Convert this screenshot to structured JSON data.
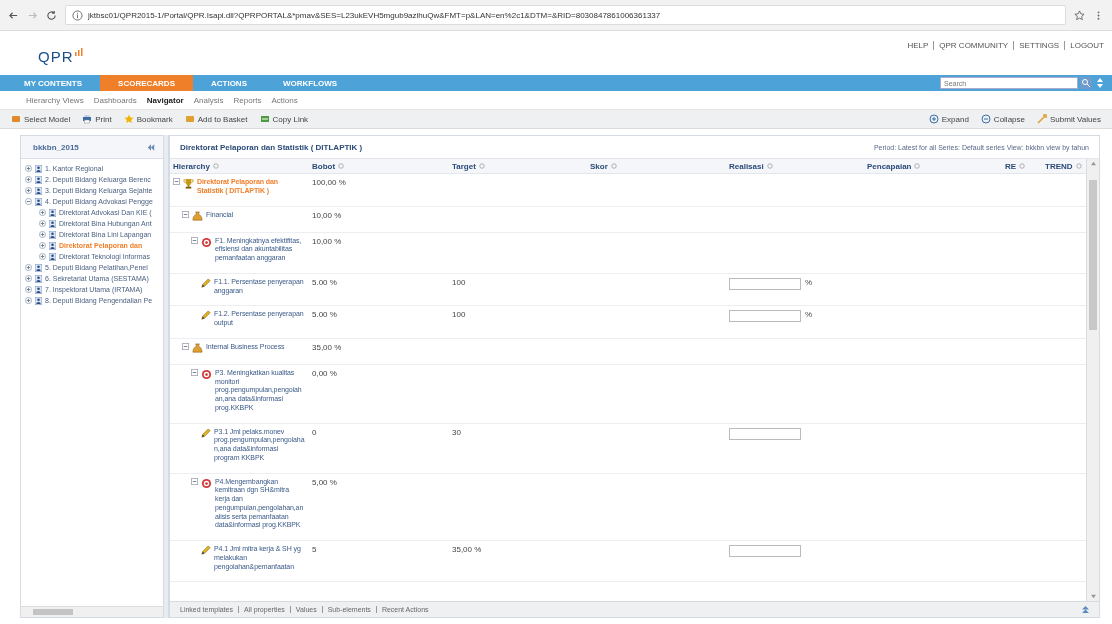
{
  "browser": {
    "url": "jktbsc01/QPR2015-1/Portal/QPR.Isapi.dll?QPRPORTAL&*pmav&SES=L23ukEVH5mgub9azihuQw&FMT=p&LAN=en%2c1&DTM=&RID=8030847861006361337"
  },
  "header": {
    "logo": "QPR",
    "links": [
      "HELP",
      "QPR COMMUNITY",
      "SETTINGS",
      "LOGOUT"
    ]
  },
  "nav_tabs": [
    {
      "label": "MY CONTENTS",
      "selected": false
    },
    {
      "label": "SCORECARDS",
      "selected": true
    },
    {
      "label": "ACTIONS",
      "selected": false
    },
    {
      "label": "WORKFLOWS",
      "selected": false
    }
  ],
  "search": {
    "placeholder": "Search"
  },
  "sub_tabs": [
    {
      "label": "Hierarchy Views",
      "selected": false
    },
    {
      "label": "Dashboards",
      "selected": false
    },
    {
      "label": "Navigator",
      "selected": true
    },
    {
      "label": "Analysis",
      "selected": false
    },
    {
      "label": "Reports",
      "selected": false
    },
    {
      "label": "Actions",
      "selected": false
    }
  ],
  "toolbar": {
    "left": [
      {
        "label": "Select Model",
        "kind": "model"
      },
      {
        "label": "Print",
        "kind": "print"
      },
      {
        "label": "Bookmark",
        "kind": "star"
      },
      {
        "label": "Add to Basket",
        "kind": "basket"
      },
      {
        "label": "Copy Link",
        "kind": "link"
      }
    ],
    "right": [
      {
        "label": "Expand",
        "kind": "expand"
      },
      {
        "label": "Collapse",
        "kind": "collapse"
      },
      {
        "label": "Submit Values",
        "kind": "submit"
      }
    ]
  },
  "sidebar": {
    "title": "bkkbn_2015",
    "items": [
      {
        "label": "1. Kantor Regional",
        "expanded": false,
        "selected": false
      },
      {
        "label": "2. Deputi Bidang Keluarga Berenc",
        "expanded": false,
        "selected": false
      },
      {
        "label": "3. Deputi Bidang Keluarga Sejahte",
        "expanded": false,
        "selected": false
      },
      {
        "label": "4. Deputi Bidang Advokasi Pengge",
        "expanded": true,
        "selected": false,
        "children": [
          {
            "label": "Direktorat Advokasi Dan KIE (",
            "expanded": false,
            "selected": false
          },
          {
            "label": "Direktorat Bina Hubungan Ant",
            "expanded": false,
            "selected": false
          },
          {
            "label": "Direktorat Bina Lini Lapangan",
            "expanded": false,
            "selected": false
          },
          {
            "label": "Direktorat Pelaporan dan",
            "expanded": false,
            "selected": true
          },
          {
            "label": "Direktorat Teknologi Informas",
            "expanded": false,
            "selected": false
          }
        ]
      },
      {
        "label": "5. Deputi Bidang Pelatihan,Penel",
        "expanded": false,
        "selected": false
      },
      {
        "label": "6. Sekretariat Utama (SESTAMA)",
        "expanded": false,
        "selected": false
      },
      {
        "label": "7. Inspektorat Utama (IRTAMA)",
        "expanded": false,
        "selected": false
      },
      {
        "label": "8. Deputi Bidang Pengendalian Pe",
        "expanded": false,
        "selected": false
      }
    ]
  },
  "main": {
    "title": "Direktorat Pelaporan dan Statistik ( DITLAPTIK )",
    "period": "Period: Latest for all  Series: Default series  View: bkkbn view by tahun",
    "columns": [
      "Hierarchy",
      "Bobot",
      "Target",
      "Skor",
      "Realisasi",
      "Pencapaian",
      "RE",
      "TREND"
    ],
    "rows": [
      {
        "kind": "scorecard",
        "name": "Direktorat Pelaporan dan Statistik ( DITLAPTIK )",
        "bobot": "100,00 %",
        "expanded": true,
        "children": [
          {
            "kind": "perspective",
            "name": "Financial",
            "bobot": "10,00 %",
            "expanded": true,
            "children": [
              {
                "kind": "objective",
                "name": "F1. Meningkatnya efektifitas, efisiensi dan akuntabilitas pemanfaatan anggaran",
                "bobot": "10,00 %",
                "expanded": true,
                "children": [
                  {
                    "kind": "measure",
                    "name": "F1.1. Persentase penyerapan anggaran",
                    "bobot": "5.00 %",
                    "target": "100",
                    "unit": "%"
                  },
                  {
                    "kind": "measure",
                    "name": "F1.2. Persentase penyerapan output",
                    "bobot": "5.00 %",
                    "target": "100",
                    "unit": "%"
                  }
                ]
              }
            ]
          },
          {
            "kind": "perspective",
            "name": "Internal Business Process",
            "bobot": "35,00 %",
            "expanded": true,
            "children": [
              {
                "kind": "objective",
                "name": "P3. Meningkatkan kualitas monitori prog.pengumpulan,pengolahan,ana data&informasi prog.KKBPK",
                "bobot": "0,00 %",
                "expanded": true,
                "children": [
                  {
                    "kind": "measure",
                    "name": "P3.1 Jml pelaks.monev prog.pengumpulan,pengolahan,ana data&informasi program KKBPK",
                    "bobot": "0",
                    "target": "30"
                  }
                ]
              },
              {
                "kind": "objective",
                "name": "P4.Mengembangkan kemitraan dgn SH&mitra kerja dan pengumpulan,pengolahan,analisis serta pemanfaatan data&informasi prog.KKBPK",
                "bobot": "5,00 %",
                "expanded": true,
                "children": [
                  {
                    "kind": "measure",
                    "name": "P4.1 Jml mitra kerja & SH yg melakukan pengolahan&pemanfaatan",
                    "bobot": "5",
                    "target": "35,00 %"
                  }
                ]
              }
            ]
          }
        ]
      }
    ]
  },
  "bottom_tabs": [
    "Linked templates",
    "All properties",
    "Values",
    "Sub-elements",
    "Recent Actions"
  ]
}
